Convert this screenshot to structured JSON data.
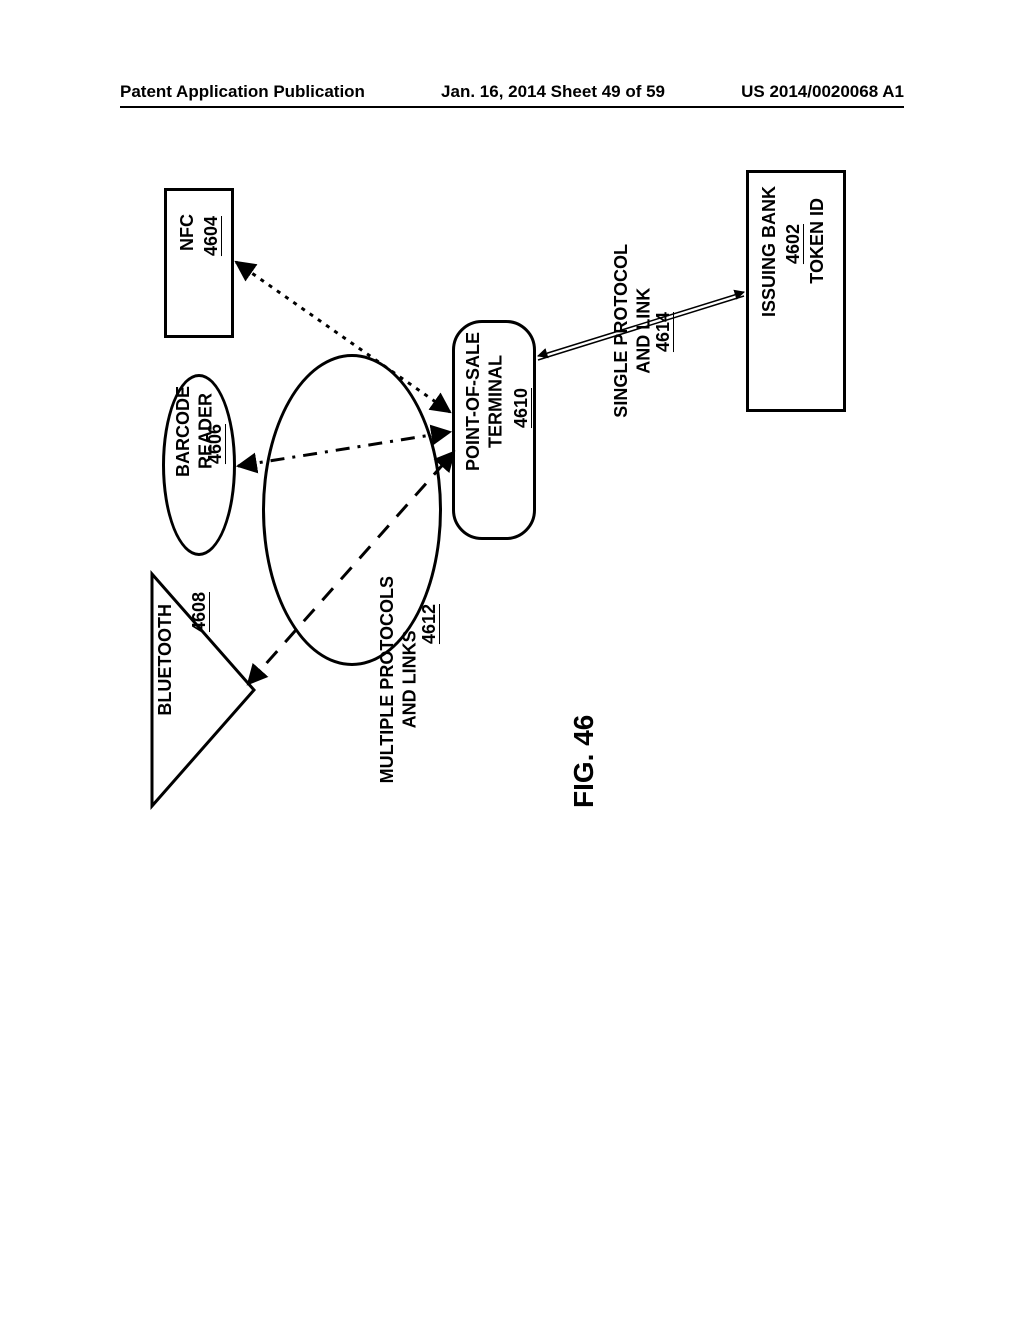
{
  "header": {
    "left": "Patent Application Publication",
    "center": "Jan. 16, 2014  Sheet 49 of 59",
    "right": "US 2014/0020068 A1"
  },
  "nfc": {
    "label": "NFC",
    "ref": "4604"
  },
  "barcode": {
    "label": "BARCODE\nREADER",
    "ref": "4606"
  },
  "bluetooth": {
    "label": "BLUETOOTH",
    "ref": "4608"
  },
  "pos": {
    "label": "POINT-OF-SALE\nTERMINAL",
    "ref": "4610"
  },
  "bank": {
    "label": "ISSUING BANK",
    "ref": "4602",
    "token": "TOKEN ID"
  },
  "multi": {
    "label": "MULTIPLE PROTOCOLS\nAND LINKS",
    "ref": "4612"
  },
  "single": {
    "label": "SINGLE PROTOCOL\nAND LINK",
    "ref": "4614"
  },
  "figure": "FIG. 46"
}
